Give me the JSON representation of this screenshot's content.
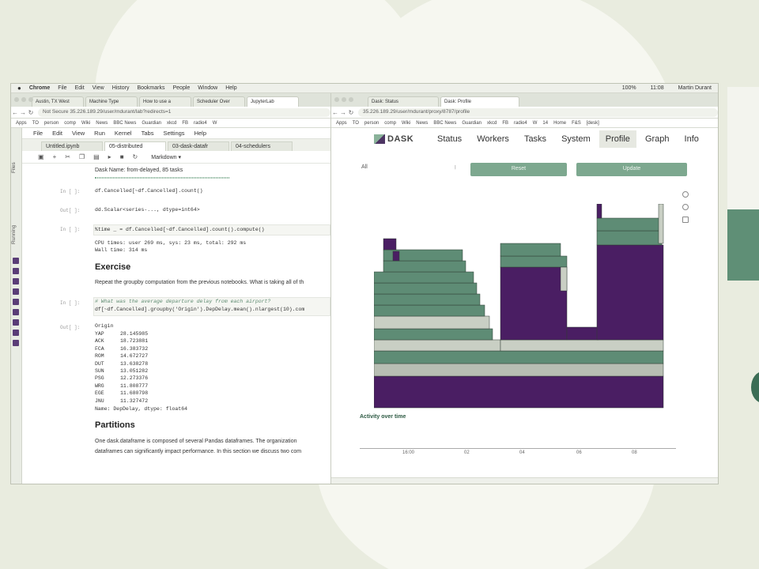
{
  "mac_menu": [
    "Chrome",
    "File",
    "Edit",
    "View",
    "History",
    "Bookmarks",
    "People",
    "Window",
    "Help"
  ],
  "mac_status": {
    "battery": "100%",
    "time": "11:08",
    "user": "Martin Durant"
  },
  "left_browser": {
    "tabs": [
      "Austin, TX West",
      "Machine Type",
      "How to use a",
      "Scheduler Over",
      "JupyterLab"
    ],
    "url": "Not Secure  35.226.189.29/user/mdurant/lab?redirects=1",
    "bookmarks": [
      "Apps",
      "TO",
      "person",
      "comp",
      "Wiki",
      "News",
      "BBC News",
      "Guardian",
      "xkcd",
      "FB",
      "radio4",
      "W"
    ]
  },
  "jupyter": {
    "sidebar": [
      "Files",
      "Running"
    ],
    "menu": [
      "File",
      "Edit",
      "View",
      "Run",
      "Kernel",
      "Tabs",
      "Settings",
      "Help"
    ],
    "tabs": [
      "Untitled.ipynb",
      "05-distributed",
      "03-dask-datafr",
      "04-schedulers"
    ],
    "cell_type": "Markdown",
    "task_line": "Dask Name: from-delayed, 85 tasks",
    "cells": [
      {
        "prompt": "In [ ]:",
        "code": "df.Cancelled[~df.Cancelled].count()"
      },
      {
        "prompt": "Out[ ]:",
        "code": "dd.Scalar<series-..., dtype=int64>"
      },
      {
        "prompt": "In [ ]:",
        "code": "%time _ = df.Cancelled[~df.Cancelled].count().compute()"
      }
    ],
    "cpu_times": "CPU times: user 269 ms, sys: 23 ms, total: 292 ms",
    "wall_time": "Wall time: 314 ms",
    "exercise_heading": "Exercise",
    "exercise_text": "Repeat the groupby computation from the previous notebooks. What is taking all of th",
    "groupby_comment": "# What was the average departure delay from each airport?",
    "groupby_code": "df[~df.Cancelled].groupby('Origin').DepDelay.mean().nlargest(10).com",
    "in_prompt": "In [ ]:",
    "out_prompt": "Out[ ]:",
    "series_header": "Origin",
    "series": [
      {
        "k": "YAP",
        "v": "28.145985"
      },
      {
        "k": "ACK",
        "v": "18.723881"
      },
      {
        "k": "FCA",
        "v": "16.383732"
      },
      {
        "k": "ROM",
        "v": "14.672727"
      },
      {
        "k": "DUT",
        "v": "13.638278"
      },
      {
        "k": "SUN",
        "v": "13.051282"
      },
      {
        "k": "PSG",
        "v": "12.273376"
      },
      {
        "k": "WRG",
        "v": "11.808777"
      },
      {
        "k": "EGE",
        "v": "11.680798"
      },
      {
        "k": "JNU",
        "v": "11.327472"
      }
    ],
    "series_footer": "Name: DepDelay, dtype: float64",
    "partitions_heading": "Partitions",
    "partitions_text1": "One dask.dataframe is composed of several Pandas dataframes. The organization",
    "partitions_text2": "dataframes can significantly impact performance. In this section we discuss two com"
  },
  "right_browser": {
    "tabs": [
      "Dask: Status",
      "Dask: Profile"
    ],
    "url": "35.226.189.29/user/mdurant/proxy/8787/profile",
    "bookmarks": [
      "Apps",
      "TO",
      "person",
      "comp",
      "Wiki",
      "News",
      "BBC News",
      "Guardian",
      "xkcd",
      "FB",
      "radio4",
      "W",
      "14",
      "Home",
      "F&S",
      "[desk]"
    ]
  },
  "dask": {
    "logo": "DASK",
    "nav": [
      "Status",
      "Workers",
      "Tasks",
      "System",
      "Profile",
      "Graph",
      "Info"
    ],
    "active_nav": "Profile",
    "selector": "All",
    "reset": "Reset",
    "update": "Update",
    "activity_title": "Activity over time",
    "activity_ticks": [
      "16:00",
      "02",
      "04",
      "06",
      "08"
    ],
    "colors": {
      "purple": "#4a1e63",
      "teal": "#5e8c75",
      "light": "#c9cfc4",
      "gray": "#b8beb3"
    }
  }
}
